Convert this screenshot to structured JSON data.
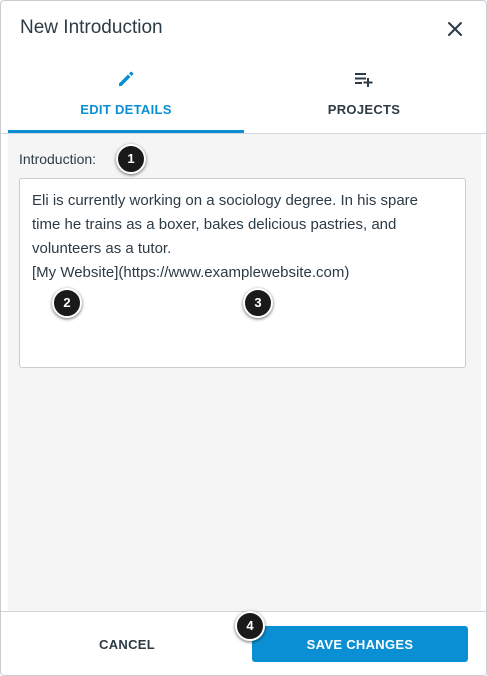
{
  "modal": {
    "title": "New Introduction",
    "close_icon": "close-icon"
  },
  "tabs": [
    {
      "label": "EDIT DETAILS",
      "icon": "pencil-icon",
      "active": true
    },
    {
      "label": "PROJECTS",
      "icon": "playlist-add-icon",
      "active": false
    }
  ],
  "form": {
    "label": "Introduction:",
    "text_lines": [
      "Eli is currently working on a sociology degree. In his spare",
      "time he trains as a boxer, bakes delicious pastries, and",
      "volunteers as a tutor.",
      "[My Website](https://www.examplewebsite.com)"
    ]
  },
  "callouts": [
    "1",
    "2",
    "3",
    "4"
  ],
  "footer": {
    "cancel_label": "CANCEL",
    "save_label": "SAVE CHANGES"
  },
  "colors": {
    "accent": "#0b8fd4",
    "text": "#2d3b45",
    "panel_bg": "#f5f5f5",
    "callout_bg": "#1a1a1a"
  }
}
